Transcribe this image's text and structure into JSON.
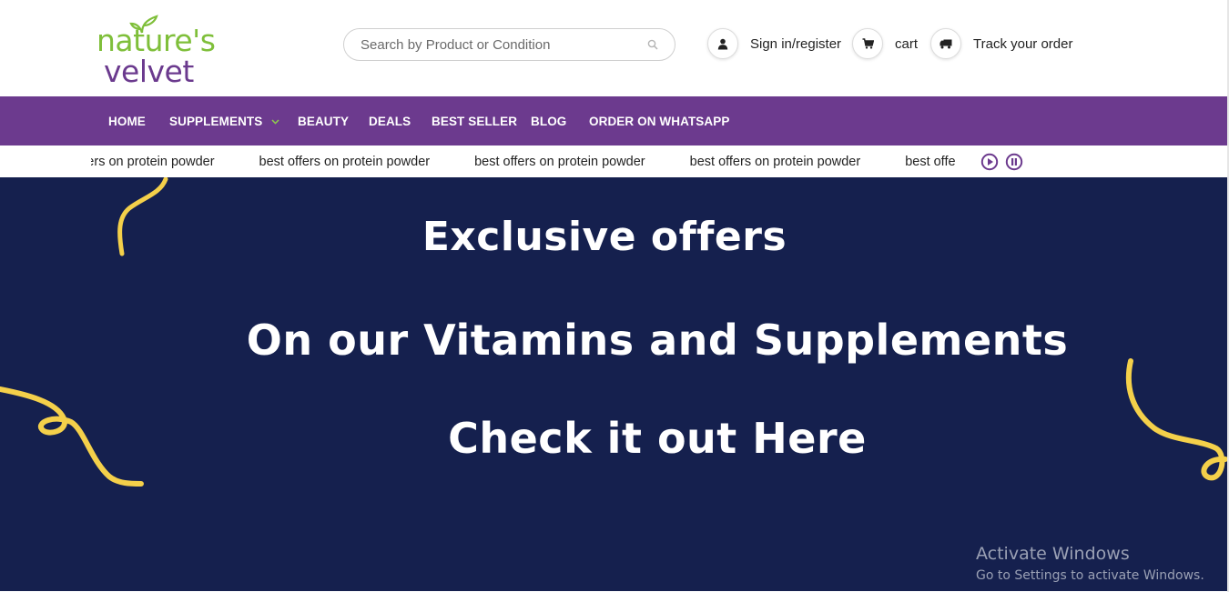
{
  "brand": {
    "logo_top": "nature's",
    "logo_bottom": "velvet"
  },
  "search": {
    "placeholder": "Search by Product or Condition"
  },
  "header_links": {
    "signin": "Sign in/register",
    "cart": "cart",
    "track": "Track your order"
  },
  "nav": {
    "items": [
      "HOME",
      "SUPPLEMENTS",
      "BEAUTY",
      "DEALS",
      "BEST SELLER",
      "BLOG",
      "ORDER ON WHATSAPP"
    ]
  },
  "ticker": {
    "items": [
      "best offers on protein powder",
      "best offers on protein powder",
      "best offers on protein powder",
      "best offers on protein powder",
      "best offers on protein powder"
    ]
  },
  "banner": {
    "line1": "Exclusive offers",
    "line2": "On our Vitamins and Supplements",
    "line3": "Check it out Here"
  },
  "overlay": {
    "activate_title": "Activate Windows",
    "activate_sub": "Go to Settings to activate Windows."
  },
  "colors": {
    "nav_bg": "#6c3a8e",
    "banner_bg": "#15204e",
    "logo_green": "#7fbf3a",
    "logo_purple": "#6b3a8e",
    "confetti": "#f4d04a"
  },
  "icons": {
    "search": "search-icon",
    "user": "user-icon",
    "cart": "cart-icon",
    "truck": "truck-icon",
    "play": "play-icon",
    "pause": "pause-icon",
    "chevron": "chevron-down-icon"
  }
}
